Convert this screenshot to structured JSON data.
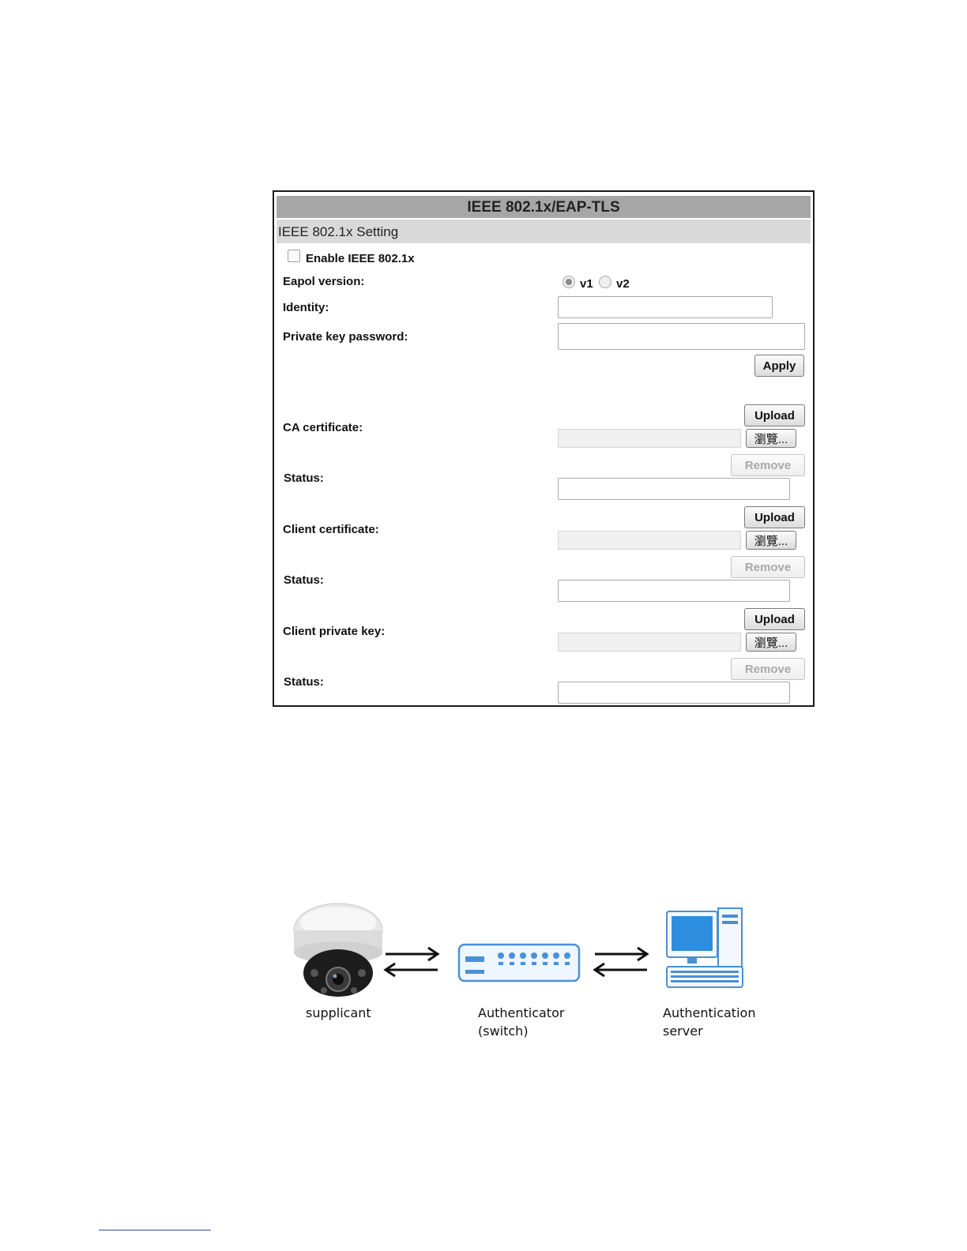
{
  "panel": {
    "title": "IEEE 802.1x/EAP-TLS",
    "section": "IEEE 802.1x Setting",
    "enable_label": "Enable IEEE 802.1x",
    "eapol_label": "Eapol version:",
    "eapol_options": [
      "v1",
      "v2"
    ],
    "eapol_selected": "v1",
    "identity_label": "Identity:",
    "private_key_password_label": "Private key password:",
    "apply_label": "Apply",
    "ca_certificate_label": "CA certificate:",
    "client_certificate_label": "Client certificate:",
    "client_private_key_label": "Client private key:",
    "status_label": "Status:",
    "upload_label": "Upload",
    "browse_label": "瀏覽...",
    "remove_label": "Remove"
  },
  "diagram": {
    "supplicant": "supplicant",
    "authenticator_line1": "Authenticator",
    "authenticator_line2": "(switch)",
    "server_line1": "Authentication",
    "server_line2": "server"
  },
  "colors": {
    "title_bar": "#a6a6a6",
    "section_bar": "#d9d9d9",
    "switch_blue": "#4a90d9",
    "monitor_blue": "#2d8ee0"
  }
}
